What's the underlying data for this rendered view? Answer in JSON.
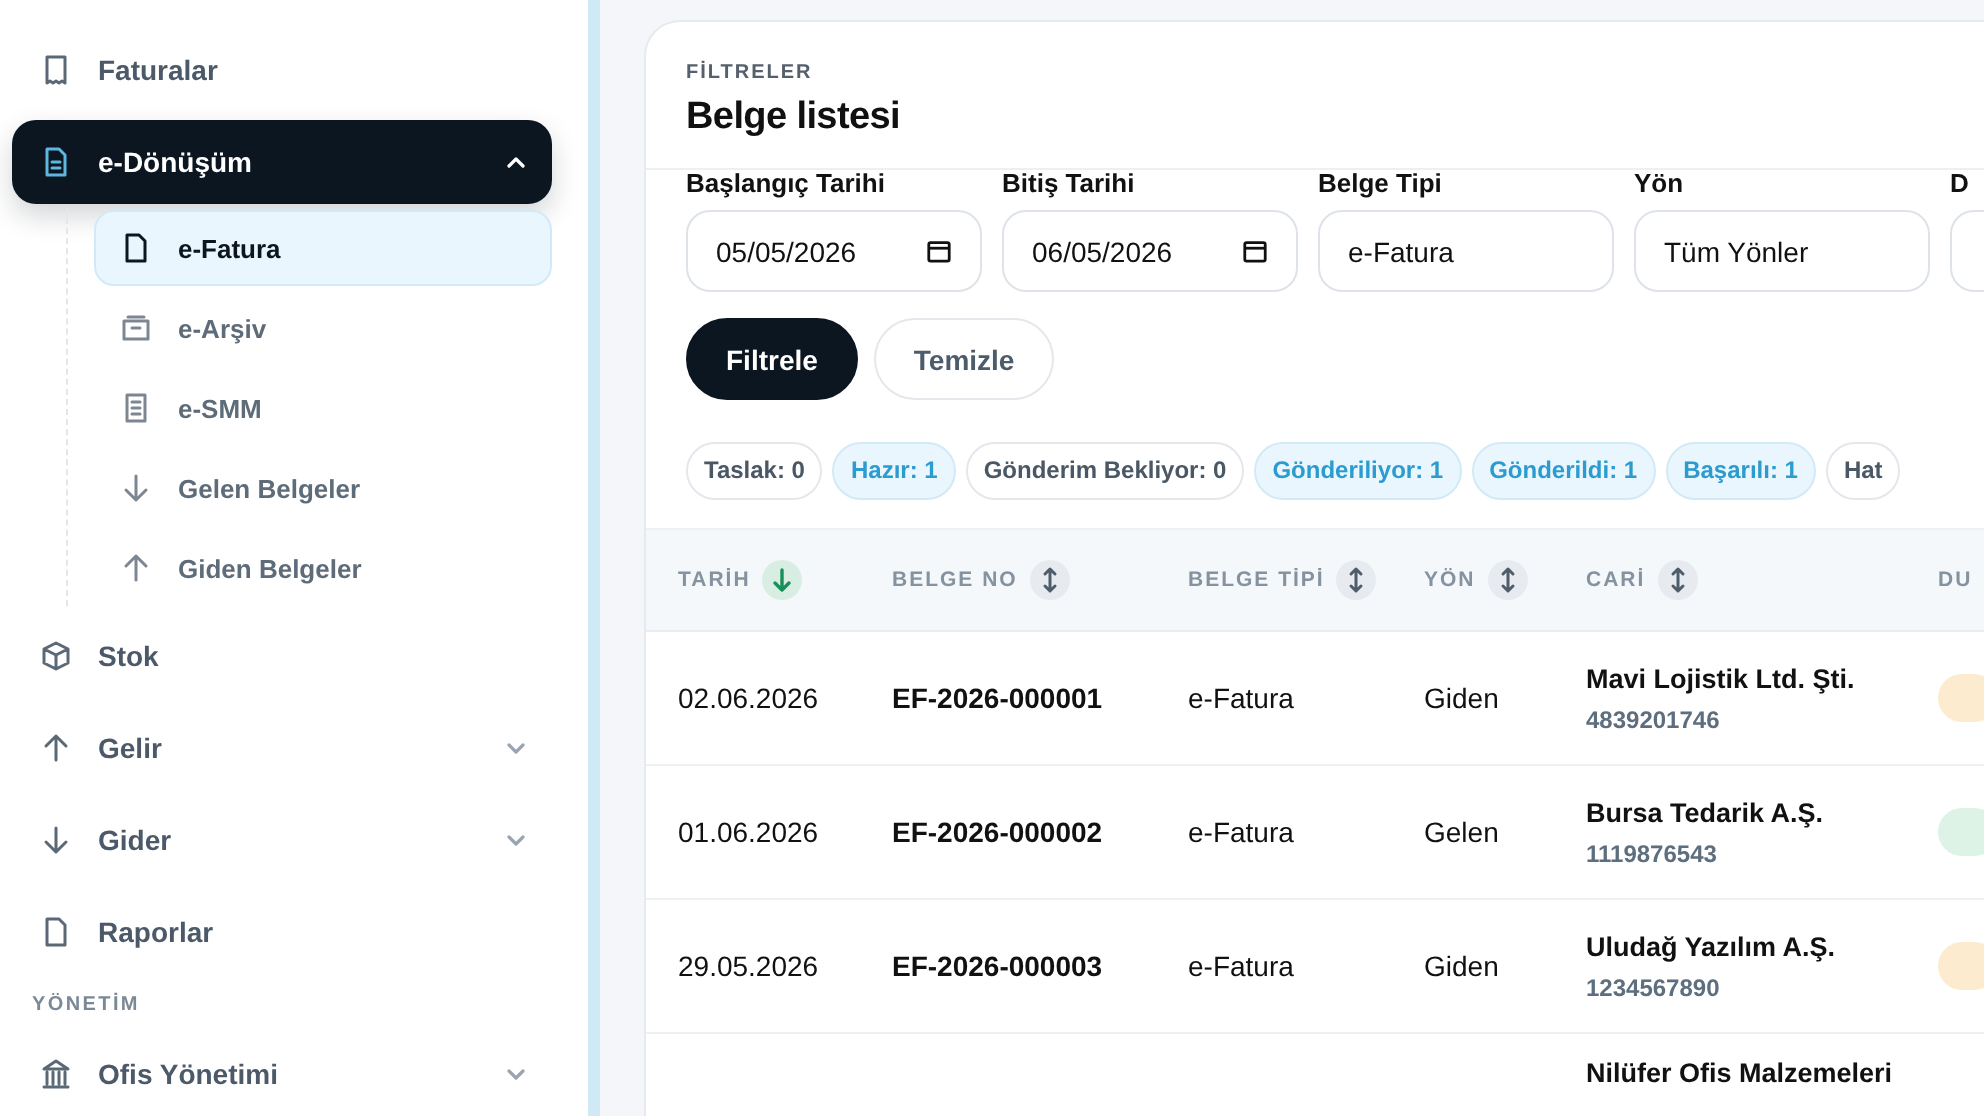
{
  "sidebar": {
    "items": [
      {
        "kind": "link",
        "label": "Faturalar",
        "selected": false
      },
      {
        "kind": "link",
        "label": "e-Dönüşüm",
        "selected": true,
        "expanded": true,
        "children": [
          {
            "label": "e-Fatura",
            "selected": true
          },
          {
            "label": "e-Arşiv",
            "selected": false
          },
          {
            "label": "e-SMM",
            "selected": false
          },
          {
            "label": "Gelen Belgeler",
            "selected": false
          },
          {
            "label": "Giden Belgeler",
            "selected": false
          }
        ]
      },
      {
        "kind": "link",
        "label": "Stok",
        "selected": false
      },
      {
        "kind": "link",
        "label": "Gelir",
        "selected": false,
        "expanded": false
      },
      {
        "kind": "link",
        "label": "Gider",
        "selected": false,
        "expanded": false
      },
      {
        "kind": "link",
        "label": "Raporlar",
        "selected": false
      },
      {
        "kind": "section",
        "label": "YÖNETİM"
      },
      {
        "kind": "link",
        "label": "Ofis Yönetimi",
        "selected": false,
        "expanded": false
      }
    ]
  },
  "card": {
    "eyebrow": "FİLTRELER",
    "title": "Belge listesi",
    "filters": [
      {
        "kind": "date",
        "label": "Başlangıç Tarihi",
        "value": "05/05/2026"
      },
      {
        "kind": "date",
        "label": "Bitiş Tarihi",
        "value": "06/05/2026"
      },
      {
        "kind": "select",
        "label": "Belge Tipi",
        "value": "e-Fatura"
      },
      {
        "kind": "select",
        "label": "Yön",
        "value": "Tüm Yönler"
      },
      {
        "kind": "select",
        "label": "D"
      }
    ],
    "buttons": [
      {
        "label": "Filtrele",
        "kind": "primary"
      },
      {
        "label": "Temizle",
        "kind": "secondary"
      }
    ],
    "status_counts": [
      {
        "label": "Taslak: 0",
        "highlighted": false
      },
      {
        "label": "Hazır: 1",
        "highlighted": true
      },
      {
        "label": "Gönderim Bekliyor: 0",
        "highlighted": false
      },
      {
        "label": "Gönderiliyor: 1",
        "highlighted": true
      },
      {
        "label": "Gönderildi: 1",
        "highlighted": true
      },
      {
        "label": "Başarılı: 1",
        "highlighted": true
      },
      {
        "label": "Hat",
        "highlighted": false
      }
    ]
  },
  "table": {
    "columns": [
      {
        "label": "TARİH",
        "sorted": true
      },
      {
        "label": "BELGE NO",
        "sorted": false
      },
      {
        "label": "BELGE TİPİ",
        "sorted": false
      },
      {
        "label": "YÖN",
        "sorted": false
      },
      {
        "label": "CARİ",
        "sorted": false
      },
      {
        "label": "DU"
      }
    ],
    "rows": [
      {
        "date": "02.06.2026",
        "number": "EF-2026-000001",
        "type": "e-Fatura",
        "direction": "Giden",
        "party": "Mavi Lojistik Ltd. Şti.",
        "tax_id": "4839201746",
        "color": "#fdebd0"
      },
      {
        "date": "01.06.2026",
        "number": "EF-2026-000002",
        "type": "e-Fatura",
        "direction": "Gelen",
        "party": "Bursa Tedarik A.Ş.",
        "tax_id": "1119876543",
        "color": "#dcf3e6"
      },
      {
        "date": "29.05.2026",
        "number": "EF-2026-000003",
        "type": "e-Fatura",
        "direction": "Giden",
        "party": "Uludağ Yazılım A.Ş.",
        "tax_id": "1234567890",
        "color": "#fdebd0"
      },
      {
        "party": "Nilüfer Ofis Malzemeleri"
      }
    ]
  }
}
